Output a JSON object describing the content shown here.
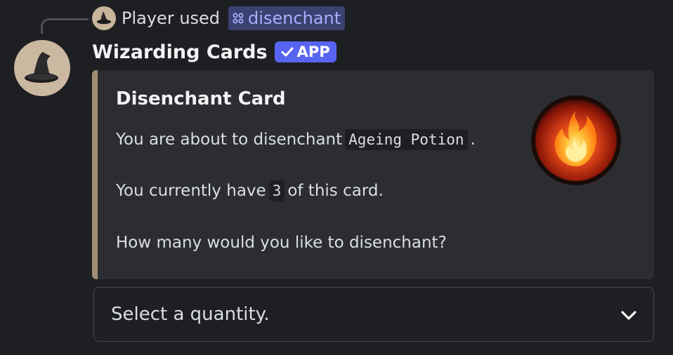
{
  "command_reference": {
    "user": "Player",
    "action": "used",
    "command": "disenchant",
    "command_icon": "slash-command-icon"
  },
  "message": {
    "author": "Wizarding Cards",
    "badge": "APP",
    "badge_icon": "checkmark-icon",
    "avatar_icon": "wizard-hat-icon"
  },
  "embed": {
    "accent_color": "#a08e74",
    "title": "Disenchant Card",
    "line1_prefix": "You are about to disenchant",
    "line1_code": "Ageing Potion",
    "line1_suffix": ".",
    "line2_prefix": "You currently have",
    "line2_code": "3",
    "line2_suffix": "of this card.",
    "line3": "How many would you like to disenchant?",
    "thumbnail_icon": "fire-icon"
  },
  "select": {
    "placeholder": "Select a quantity.",
    "chevron_icon": "chevron-down-icon"
  },
  "colors": {
    "background": "#1e1f22",
    "embed_background": "#2b2d31",
    "brand": "#5865f2",
    "command_chip": "#3b4170"
  }
}
